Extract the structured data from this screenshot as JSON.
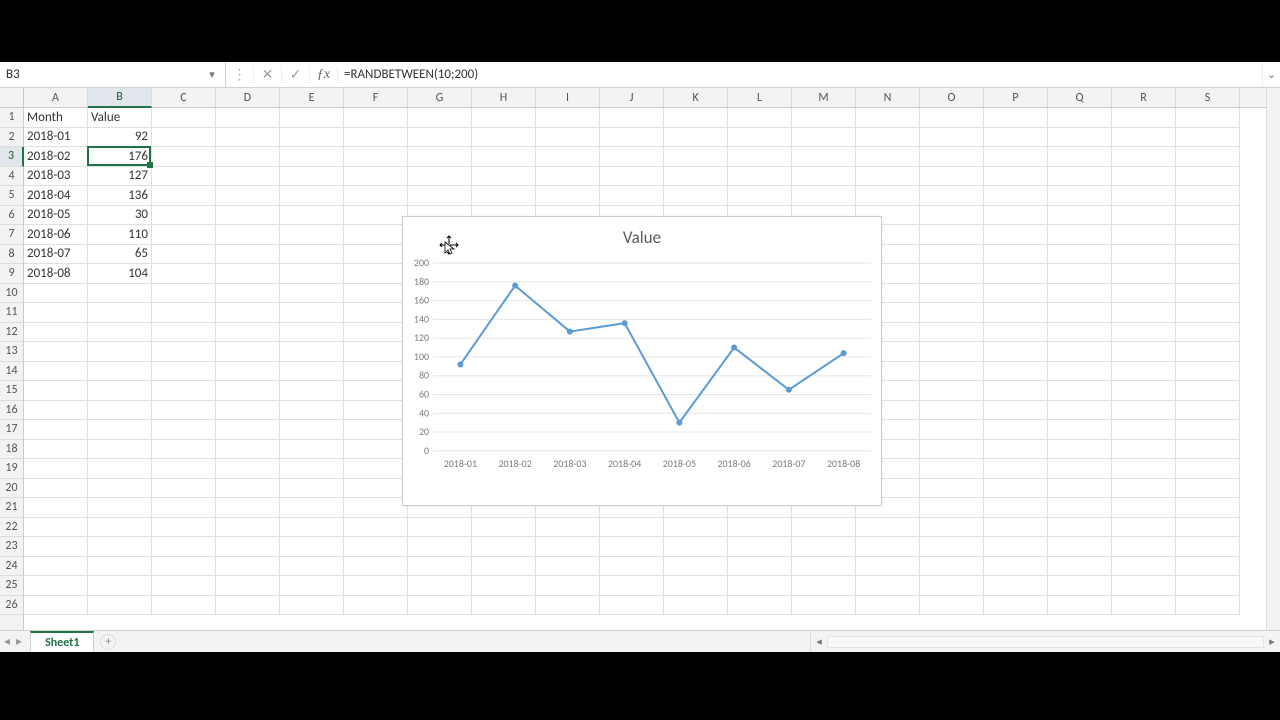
{
  "name_box": "B3",
  "formula": "=RANDBETWEEN(10;200)",
  "columns": [
    "A",
    "B",
    "C",
    "D",
    "E",
    "F",
    "G",
    "H",
    "I",
    "J",
    "K",
    "L",
    "M",
    "N",
    "O",
    "P",
    "Q",
    "R",
    "S"
  ],
  "row_count": 26,
  "selected": {
    "col": 1,
    "row": 2
  },
  "headers_row": [
    "Month",
    "Value"
  ],
  "data_rows": [
    [
      "2018-01",
      92
    ],
    [
      "2018-02",
      176
    ],
    [
      "2018-03",
      127
    ],
    [
      "2018-04",
      136
    ],
    [
      "2018-05",
      30
    ],
    [
      "2018-06",
      110
    ],
    [
      "2018-07",
      65
    ],
    [
      "2018-08",
      104
    ]
  ],
  "sheet_tabs": [
    "Sheet1"
  ],
  "chart": {
    "title": "Value",
    "y_ticks": [
      0,
      20,
      40,
      60,
      80,
      100,
      120,
      140,
      160,
      180,
      200
    ],
    "ymax": 200
  },
  "chart_data": {
    "type": "line",
    "title": "Value",
    "xlabel": "",
    "ylabel": "",
    "ylim": [
      0,
      200
    ],
    "categories": [
      "2018-01",
      "2018-02",
      "2018-03",
      "2018-04",
      "2018-05",
      "2018-06",
      "2018-07",
      "2018-08"
    ],
    "values": [
      92,
      176,
      127,
      136,
      30,
      110,
      65,
      104
    ]
  }
}
